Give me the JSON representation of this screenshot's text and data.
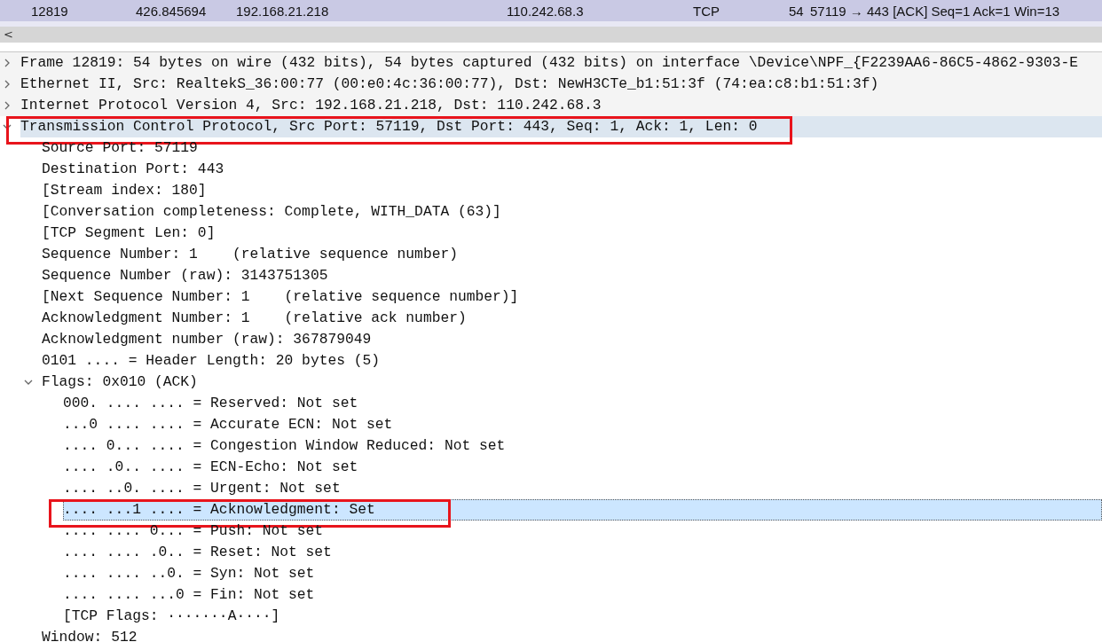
{
  "packet_list": {
    "rows": [
      {
        "cells": [
          "12819",
          "426.845694",
          "192.168.21.218",
          "110.242.68.3",
          "TCP",
          "54",
          "57119 → 443 [ACK] Seq=1 Ack=1 Win=13"
        ],
        "selected": true
      }
    ]
  },
  "scroll_left": "<",
  "details_tree": [
    {
      "text": "Frame 12819: 54 bytes on wire (432 bits), 54 bytes captured (432 bits) on interface \\Device\\NPF_{F2239AA6-86C5-4862-9303-E",
      "expanded": false,
      "selected": false,
      "annotated": false
    },
    {
      "text": "Ethernet II, Src: RealtekS_36:00:77 (00:e0:4c:36:00:77), Dst: NewH3CTe_b1:51:3f (74:ea:c8:b1:51:3f)",
      "expanded": false,
      "selected": false,
      "annotated": false
    },
    {
      "text": "Internet Protocol Version 4, Src: 192.168.21.218, Dst: 110.242.68.3",
      "expanded": false,
      "selected": false,
      "annotated": false
    },
    {
      "text": "Transmission Control Protocol, Src Port: 57119, Dst Port: 443, Seq: 1, Ack: 1, Len: 0",
      "expanded": true,
      "selected": false,
      "annotated": true,
      "children": [
        {
          "text": "Source Port: 57119",
          "selected": false,
          "annotated": false
        },
        {
          "text": "Destination Port: 443",
          "selected": false,
          "annotated": false
        },
        {
          "text": "[Stream index: 180]",
          "selected": false,
          "annotated": false
        },
        {
          "text": "[Conversation completeness: Complete, WITH_DATA (63)]",
          "selected": false,
          "annotated": false
        },
        {
          "text": "[TCP Segment Len: 0]",
          "selected": false,
          "annotated": false
        },
        {
          "text": "Sequence Number: 1    (relative sequence number)",
          "selected": false,
          "annotated": false
        },
        {
          "text": "Sequence Number (raw): 3143751305",
          "selected": false,
          "annotated": false
        },
        {
          "text": "[Next Sequence Number: 1    (relative sequence number)]",
          "selected": false,
          "annotated": false
        },
        {
          "text": "Acknowledgment Number: 1    (relative ack number)",
          "selected": false,
          "annotated": false
        },
        {
          "text": "Acknowledgment number (raw): 367879049",
          "selected": false,
          "annotated": false
        },
        {
          "text": "0101 .... = Header Length: 20 bytes (5)",
          "selected": false,
          "annotated": false
        },
        {
          "text": "Flags: 0x010 (ACK)",
          "expanded": true,
          "selected": false,
          "annotated": false,
          "children": [
            {
              "text": "000. .... .... = Reserved: Not set",
              "selected": false,
              "annotated": false
            },
            {
              "text": "...0 .... .... = Accurate ECN: Not set",
              "selected": false,
              "annotated": false
            },
            {
              "text": ".... 0... .... = Congestion Window Reduced: Not set",
              "selected": false,
              "annotated": false
            },
            {
              "text": ".... .0.. .... = ECN-Echo: Not set",
              "selected": false,
              "annotated": false
            },
            {
              "text": ".... ..0. .... = Urgent: Not set",
              "selected": false,
              "annotated": false
            },
            {
              "text": ".... ...1 .... = Acknowledgment: Set",
              "selected": true,
              "annotated": true
            },
            {
              "text": ".... .... 0... = Push: Not set",
              "selected": false,
              "annotated": false
            },
            {
              "text": ".... .... .0.. = Reset: Not set",
              "selected": false,
              "annotated": false
            },
            {
              "text": ".... .... ..0. = Syn: Not set",
              "selected": false,
              "annotated": false
            },
            {
              "text": ".... .... ...0 = Fin: Not set",
              "selected": false,
              "annotated": false
            },
            {
              "text": "[TCP Flags: ·······A····]",
              "selected": false,
              "annotated": false
            }
          ]
        },
        {
          "text": "Window: 512",
          "selected": false,
          "annotated": false
        }
      ]
    }
  ]
}
